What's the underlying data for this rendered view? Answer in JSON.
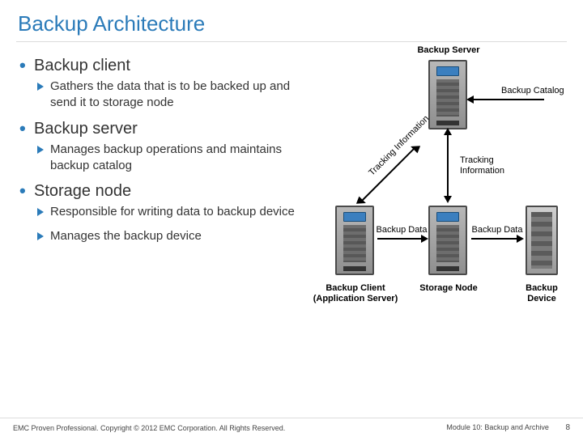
{
  "title": "Backup Architecture",
  "sections": {
    "client": {
      "heading": "Backup client",
      "b1": "Gathers the data that is to be backed up and send it to storage node"
    },
    "server": {
      "heading": "Backup server",
      "b1": "Manages backup operations and maintains backup catalog"
    },
    "node": {
      "heading": "Storage node",
      "b1": "Responsible for writing data to backup device",
      "b2": "Manages the backup device"
    }
  },
  "diagram": {
    "backup_server": "Backup Server",
    "backup_catalog": "Backup Catalog",
    "tracking_info_diag": "Tracking Information",
    "tracking_info_right": "Tracking Information",
    "backup_data_left": "Backup Data",
    "backup_data_right": "Backup Data",
    "backup_client": "Backup Client",
    "app_server": "(Application Server)",
    "storage_node": "Storage Node",
    "backup_device": "Backup Device"
  },
  "footer": {
    "left": "EMC Proven Professional. Copyright © 2012 EMC Corporation. All Rights Reserved.",
    "right": "Module 10: Backup and Archive",
    "page": "8"
  }
}
